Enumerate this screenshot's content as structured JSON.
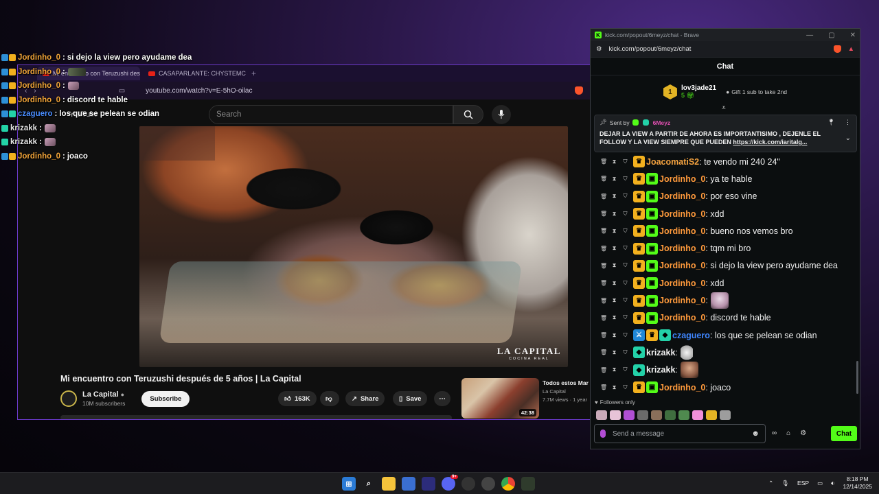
{
  "overlay_chat": [
    {
      "badges": [
        "blue",
        "gold"
      ],
      "name": "Jordinho_0",
      "color": "orange",
      "message": "si dejo la view pero ayudame dea",
      "emote": false
    },
    {
      "badges": [
        "blue",
        "gold"
      ],
      "name": "Jordinho_0",
      "color": "orange",
      "message": "",
      "emote": "wide"
    },
    {
      "badges": [
        "blue",
        "gold"
      ],
      "name": "Jordinho_0",
      "color": "orange",
      "message": "",
      "emote": "small"
    },
    {
      "badges": [
        "blue",
        "gold"
      ],
      "name": "Jordinho_0",
      "color": "orange",
      "message": "discord te hable",
      "emote": false
    },
    {
      "badges": [
        "blue",
        "teal"
      ],
      "name": "czaguero",
      "color": "blue",
      "message": "los que se pelean se odian",
      "emote": false
    },
    {
      "badges": [
        "teal"
      ],
      "name": "krizakk",
      "color": "white",
      "message": "",
      "emote": "small"
    },
    {
      "badges": [
        "teal"
      ],
      "name": "krizakk",
      "color": "white",
      "message": "",
      "emote": "small"
    },
    {
      "badges": [
        "blue",
        "gold"
      ],
      "name": "Jordinho_0",
      "color": "orange",
      "message": "joaco",
      "emote": false
    }
  ],
  "browser": {
    "tabs": [
      {
        "label": "Mi encuentro con Teruzushi desp",
        "active": true
      },
      {
        "label": "CASAPARLANTE: CHYSTEMC | Boom",
        "active": false
      }
    ],
    "url": "youtube.com/watch?v=E-5hO-oilac",
    "yt_logo_text": "YouTube",
    "search_placeholder": "Search",
    "video_brand": "LA CAPITAL",
    "video_brand_sub": "COCINA REAL",
    "video_title": "Mi encuentro con Teruzushi después de 5 años | La Capital",
    "channel_name": "La Capital",
    "channel_subs": "10M subscribers",
    "subscribe_label": "Subscribe",
    "likes": "163K",
    "share_label": "Share",
    "save_label": "Save",
    "rec_title": "Todos estos Mar llegaron desde J",
    "rec_channel": "La Capital",
    "rec_meta": "7.7M views · 1 year",
    "rec_duration": "42:38"
  },
  "kick": {
    "window_title": "kick.com/popout/6meyz/chat - Brave",
    "url": "kick.com/popout/6meyz/chat",
    "header": "Chat",
    "top_gifter": {
      "rank": "1",
      "name": "lov3jade21",
      "count": "5",
      "cta": "Gift 1 sub to take 2nd"
    },
    "pinned": {
      "sent_by": "Sent by",
      "user": "6Meyz",
      "message": "DEJAR LA VIEW A PARTIR DE AHORA ES IMPORTANTISIMO , DEJENLE EL FOLLOW Y LA VIEW SIEMPRE QUE PUEDEN",
      "link": "https://kick.com/iaritalg..."
    },
    "messages": [
      {
        "badges": [
          "crown"
        ],
        "name": "JoacomatiS2",
        "name_color": "orange2",
        "text": ": te vendo mi 240 24\"",
        "emote": ""
      },
      {
        "badges": [
          "crown",
          "gift"
        ],
        "name": "Jordinho_0",
        "name_color": "orange",
        "text": ": ya te hable",
        "emote": ""
      },
      {
        "badges": [
          "crown",
          "gift"
        ],
        "name": "Jordinho_0",
        "name_color": "orange",
        "text": ": por eso vine",
        "emote": ""
      },
      {
        "badges": [
          "crown",
          "gift"
        ],
        "name": "Jordinho_0",
        "name_color": "orange",
        "text": ": xdd",
        "emote": ""
      },
      {
        "badges": [
          "crown",
          "gift"
        ],
        "name": "Jordinho_0",
        "name_color": "orange",
        "text": ": bueno nos vemos bro",
        "emote": ""
      },
      {
        "badges": [
          "crown",
          "gift"
        ],
        "name": "Jordinho_0",
        "name_color": "orange",
        "text": ": tqm mi bro",
        "emote": ""
      },
      {
        "badges": [
          "crown",
          "gift"
        ],
        "name": "Jordinho_0",
        "name_color": "orange",
        "text": ": si dejo la view pero ayudame dea",
        "emote": ""
      },
      {
        "badges": [
          "crown",
          "gift"
        ],
        "name": "Jordinho_0",
        "name_color": "orange",
        "text": ": xdd",
        "emote": ""
      },
      {
        "badges": [
          "crown",
          "gift"
        ],
        "name": "Jordinho_0",
        "name_color": "orange",
        "text": ":",
        "emote": "pink"
      },
      {
        "badges": [
          "crown",
          "gift"
        ],
        "name": "Jordinho_0",
        "name_color": "orange",
        "text": ": discord te hable",
        "emote": ""
      },
      {
        "badges": [
          "sword",
          "crown",
          "teal"
        ],
        "name": "czaguero",
        "name_color": "blue",
        "text": ": los que se pelean se odian",
        "emote": ""
      },
      {
        "badges": [
          "teal"
        ],
        "name": "krizakk",
        "name_color": "white",
        "text": ":",
        "emote": "bunny"
      },
      {
        "badges": [
          "teal"
        ],
        "name": "krizakk",
        "name_color": "white",
        "text": ":",
        "emote": "face"
      },
      {
        "badges": [
          "crown",
          "gift"
        ],
        "name": "Jordinho_0",
        "name_color": "orange",
        "text": ": joaco",
        "emote": ""
      }
    ],
    "followers_only": "Followers only",
    "send_placeholder": "Send a message",
    "chat_button": "Chat"
  },
  "taskbar": {
    "lang": "ESP",
    "time": "8:18 PM",
    "date": "12/14/2025",
    "discord_badge": "9+"
  },
  "colors": {
    "kick_green": "#53fc18",
    "browser_border": "#6b3ac9",
    "name_orange": "#ff9a3c",
    "name_blue": "#3f86ff"
  }
}
